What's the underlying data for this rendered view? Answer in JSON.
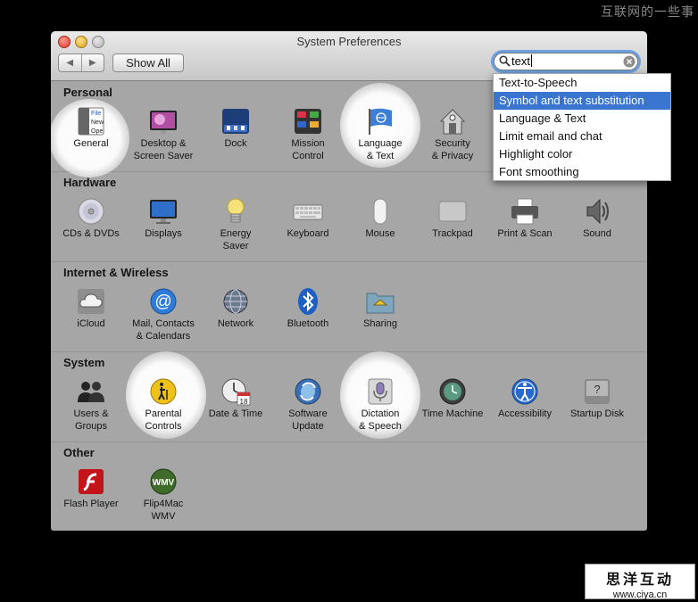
{
  "watermark_top": "互联网的一些事",
  "watermark_box": {
    "line1": "思洋互动",
    "line2": "www.ciya.cn"
  },
  "window": {
    "title": "System Preferences"
  },
  "toolbar": {
    "back": "◀",
    "forward": "▶",
    "show_all": "Show All"
  },
  "search": {
    "value": "text"
  },
  "sections": {
    "personal": {
      "title": "Personal",
      "items": [
        {
          "label": "General"
        },
        {
          "label": "Desktop &\nScreen Saver"
        },
        {
          "label": "Dock"
        },
        {
          "label": "Mission\nControl"
        },
        {
          "label": "Language\n& Text"
        },
        {
          "label": "Security\n& Privacy"
        }
      ]
    },
    "hardware": {
      "title": "Hardware",
      "items": [
        {
          "label": "CDs & DVDs"
        },
        {
          "label": "Displays"
        },
        {
          "label": "Energy\nSaver"
        },
        {
          "label": "Keyboard"
        },
        {
          "label": "Mouse"
        },
        {
          "label": "Trackpad"
        },
        {
          "label": "Print & Scan"
        },
        {
          "label": "Sound"
        }
      ]
    },
    "internet": {
      "title": "Internet & Wireless",
      "items": [
        {
          "label": "iCloud"
        },
        {
          "label": "Mail, Contacts\n& Calendars"
        },
        {
          "label": "Network"
        },
        {
          "label": "Bluetooth"
        },
        {
          "label": "Sharing"
        }
      ]
    },
    "system": {
      "title": "System",
      "items": [
        {
          "label": "Users &\nGroups"
        },
        {
          "label": "Parental\nControls"
        },
        {
          "label": "Date & Time"
        },
        {
          "label": "Software\nUpdate"
        },
        {
          "label": "Dictation\n& Speech"
        },
        {
          "label": "Time Machine"
        },
        {
          "label": "Accessibility"
        },
        {
          "label": "Startup Disk"
        }
      ]
    },
    "other": {
      "title": "Other",
      "items": [
        {
          "label": "Flash Player"
        },
        {
          "label": "Flip4Mac\nWMV"
        }
      ]
    }
  },
  "dropdown": {
    "items": [
      "Text-to-Speech",
      "Symbol and text substitution",
      "Language & Text",
      "Limit email and chat",
      "Highlight color",
      "Font smoothing"
    ],
    "selected_index": 1
  },
  "colors": {
    "selection": "#3a76d0",
    "window_bg": "#a6a6a6",
    "search_focus": "#6d9fdc"
  }
}
